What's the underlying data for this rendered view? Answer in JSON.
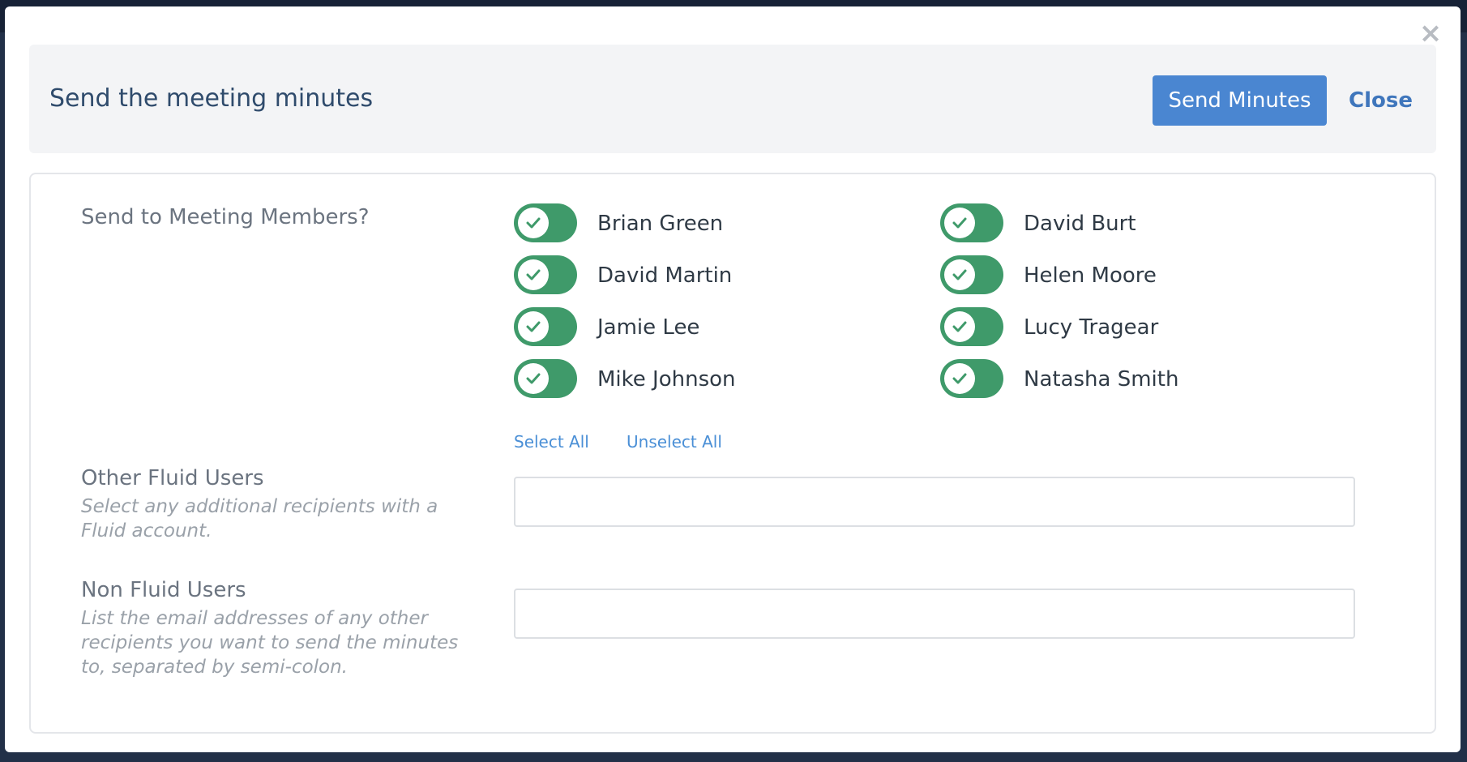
{
  "dialog": {
    "title": "Send the meeting minutes",
    "close_icon": "close-icon",
    "send_button_label": "Send Minutes",
    "close_button_label": "Close"
  },
  "members_section": {
    "label": "Send to Meeting Members?",
    "members": [
      {
        "name": "Brian Green",
        "checked": true
      },
      {
        "name": "David Burt",
        "checked": true
      },
      {
        "name": "David Martin",
        "checked": true
      },
      {
        "name": "Helen Moore",
        "checked": true
      },
      {
        "name": "Jamie Lee",
        "checked": true
      },
      {
        "name": "Lucy Tragear",
        "checked": true
      },
      {
        "name": "Mike Johnson",
        "checked": true
      },
      {
        "name": "Natasha Smith",
        "checked": true
      }
    ],
    "select_all_label": "Select All",
    "unselect_all_label": "Unselect All"
  },
  "other_fluid_users": {
    "label": "Other Fluid Users",
    "help": "Select any additional recipients with a Fluid account.",
    "value": ""
  },
  "non_fluid_users": {
    "label": "Non Fluid Users",
    "help": "List the email addresses of any other recipients you want to send the minutes to, separated by semi-colon.",
    "value": ""
  },
  "colors": {
    "primary": "#4a86d1",
    "toggle_on": "#3f9a6a",
    "title": "#2f4b6c",
    "link": "#4a8fd6"
  }
}
